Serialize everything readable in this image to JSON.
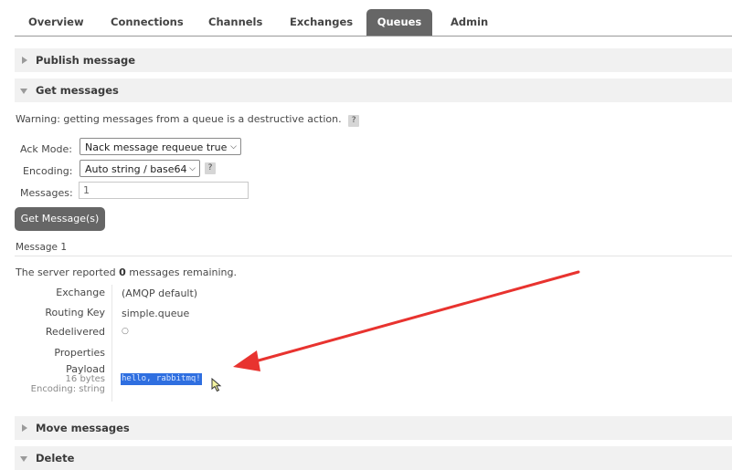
{
  "tabs": [
    {
      "label": "Overview",
      "active": false
    },
    {
      "label": "Connections",
      "active": false
    },
    {
      "label": "Channels",
      "active": false
    },
    {
      "label": "Exchanges",
      "active": false
    },
    {
      "label": "Queues",
      "active": true
    },
    {
      "label": "Admin",
      "active": false
    }
  ],
  "sections": {
    "publish": {
      "title": "Publish message",
      "expanded": false
    },
    "get": {
      "title": "Get messages",
      "expanded": true
    },
    "move": {
      "title": "Move messages",
      "expanded": false
    },
    "delete": {
      "title": "Delete",
      "expanded": true
    }
  },
  "get_messages": {
    "warning": "Warning: getting messages from a queue is a destructive action.",
    "help": "?",
    "ack_mode_label": "Ack Mode:",
    "ack_mode_value": "Nack message requeue true",
    "encoding_label": "Encoding:",
    "encoding_value": "Auto string / base64",
    "messages_label": "Messages:",
    "messages_value": "1",
    "button": "Get Message(s)"
  },
  "result": {
    "message_heading": "Message 1",
    "reported_prefix": "The server reported ",
    "remaining_count": "0",
    "reported_suffix": " messages remaining.",
    "exchange_label": "Exchange",
    "exchange_value": "(AMQP default)",
    "routing_key_label": "Routing Key",
    "routing_key_value": "simple.queue",
    "redelivered_label": "Redelivered",
    "redelivered_value": "○",
    "properties_label": "Properties",
    "payload_label": "Payload",
    "payload_size": "16 bytes",
    "payload_encoding": "Encoding: string",
    "payload_value": "hello, rabbitmq!"
  },
  "annotation": {
    "arrow_color": "#e8332f"
  },
  "colors": {
    "tab_active": "#666666",
    "section_bg": "#f1f1f1",
    "selection": "#2f6fe0"
  }
}
